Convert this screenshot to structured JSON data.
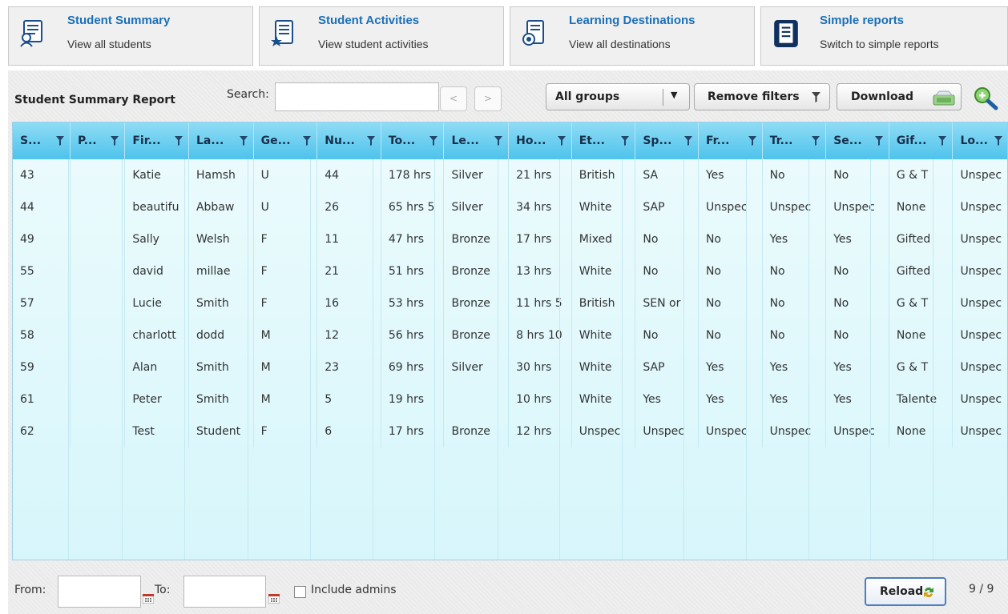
{
  "nav": [
    {
      "title": "Student Summary",
      "subtitle": "View all students",
      "icon": "student-icon"
    },
    {
      "title": "Student Activities",
      "subtitle": "View student activities",
      "icon": "activities-icon"
    },
    {
      "title": "Learning Destinations",
      "subtitle": "View all destinations",
      "icon": "destinations-icon"
    },
    {
      "title": "Simple reports",
      "subtitle": "Switch to simple reports",
      "icon": "report-icon"
    }
  ],
  "report": {
    "title": "Student Summary Report",
    "search_label": "Search:",
    "search_value": "",
    "prev_label": "<",
    "next_label": ">",
    "groups_selected": "All groups",
    "remove_filters_label": "Remove filters",
    "download_label": "Download"
  },
  "table": {
    "headers": [
      "S...",
      "P...",
      "Fir...",
      "La...",
      "Ge...",
      "Nu...",
      "To...",
      "Le...",
      "Ho...",
      "Et...",
      "Sp...",
      "Fr...",
      "Tr...",
      "Se...",
      "Gif...",
      "Lo..."
    ],
    "rows": [
      [
        "43",
        "",
        "Katie",
        "Hamsh",
        "U",
        "44",
        "178 hrs",
        "Silver",
        "21 hrs",
        "British",
        "SA",
        "Yes",
        "No",
        "No",
        "G & T",
        "Unspec"
      ],
      [
        "44",
        "",
        "beautifu",
        "Abbaw",
        "U",
        "26",
        "65 hrs 5",
        "Silver",
        "34 hrs",
        "White",
        "SAP",
        "Unspec",
        "Unspec",
        "Unspec",
        "None",
        "Unspec"
      ],
      [
        "49",
        "",
        "Sally",
        "Welsh",
        "F",
        "11",
        "47 hrs",
        "Bronze",
        "17 hrs",
        "Mixed",
        "No",
        "No",
        "Yes",
        "Yes",
        "Gifted",
        "Unspec"
      ],
      [
        "55",
        "",
        "david",
        "millae",
        "F",
        "21",
        "51 hrs",
        "Bronze",
        "13 hrs",
        "White",
        "No",
        "No",
        "No",
        "No",
        "Gifted",
        "Unspec"
      ],
      [
        "57",
        "",
        "Lucie",
        "Smith",
        "F",
        "16",
        "53 hrs",
        "Bronze",
        "11 hrs 5",
        "British",
        "SEN or",
        "No",
        "No",
        "No",
        "G & T",
        "Unspec"
      ],
      [
        "58",
        "",
        "charlott",
        "dodd",
        "M",
        "12",
        "56 hrs",
        "Bronze",
        "8 hrs 10",
        "White",
        "No",
        "No",
        "No",
        "No",
        "None",
        "Unspec"
      ],
      [
        "59",
        "",
        "Alan",
        "Smith",
        "M",
        "23",
        "69 hrs",
        "Silver",
        "30 hrs",
        "White",
        "SAP",
        "Yes",
        "Yes",
        "Yes",
        "G & T",
        "Unspec"
      ],
      [
        "61",
        "",
        "Peter",
        "Smith",
        "M",
        "5",
        "19 hrs",
        "",
        "10 hrs",
        "White",
        "Yes",
        "Yes",
        "Yes",
        "Yes",
        "Talente",
        "Unspec"
      ],
      [
        "62",
        "",
        "Test",
        "Student",
        "F",
        "6",
        "17 hrs",
        "Bronze",
        "12 hrs",
        "Unspec",
        "Unspec",
        "Unspec",
        "Unspec",
        "Unspec",
        "None",
        "Unspec"
      ]
    ]
  },
  "footer": {
    "from_label": "From:",
    "to_label": "To:",
    "from_value": "",
    "to_value": "",
    "include_admins_label": "Include admins",
    "reload_label": "Reload",
    "count": "9 / 9"
  },
  "colors": {
    "nav_title": "#1a6fb8",
    "header_top": "#8fdcf5",
    "header_bottom": "#4ec3ec",
    "grid_bg": "#e3f8fc",
    "reload_border": "#4a7fc0"
  }
}
